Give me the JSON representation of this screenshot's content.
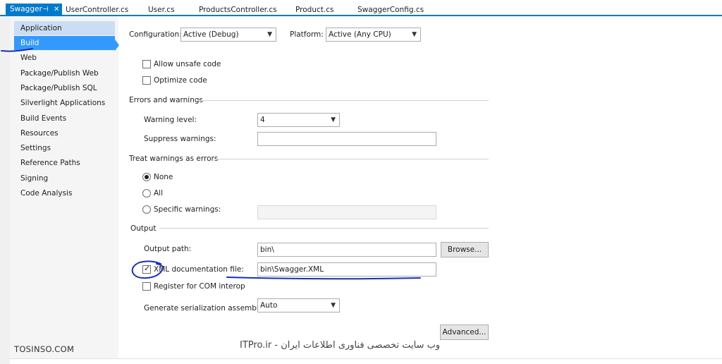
{
  "tabs": [
    {
      "label": "Swagger",
      "pin": "⊣",
      "close": "✕",
      "active": true
    },
    {
      "label": "UserController.cs"
    },
    {
      "label": "User.cs"
    },
    {
      "label": "ProductsController.cs"
    },
    {
      "label": "Product.cs"
    },
    {
      "label": "SwaggerConfig.cs"
    }
  ],
  "sidebar": {
    "items": [
      {
        "label": "Application"
      },
      {
        "label": "Build"
      },
      {
        "label": "Web"
      },
      {
        "label": "Package/Publish Web"
      },
      {
        "label": "Package/Publish SQL"
      },
      {
        "label": "Silverlight Applications"
      },
      {
        "label": "Build Events"
      },
      {
        "label": "Resources"
      },
      {
        "label": "Settings"
      },
      {
        "label": "Reference Paths"
      },
      {
        "label": "Signing"
      },
      {
        "label": "Code Analysis"
      }
    ]
  },
  "config": {
    "configuration_label": "Configuration:",
    "configuration_value": "Active (Debug)",
    "platform_label": "Platform:",
    "platform_value": "Active (Any CPU)"
  },
  "general": {
    "unsafe_label": "Allow unsafe code",
    "unsafe_checked": false,
    "optimize_label": "Optimize code",
    "optimize_checked": false
  },
  "errors": {
    "heading": "Errors and warnings",
    "warning_level_label": "Warning level:",
    "warning_level_value": "4",
    "suppress_label": "Suppress warnings:",
    "suppress_value": ""
  },
  "treat": {
    "heading": "Treat warnings as errors",
    "none_label": "None",
    "all_label": "All",
    "specific_label": "Specific warnings:",
    "selected": "None"
  },
  "output": {
    "heading": "Output",
    "path_label": "Output path:",
    "path_value": "bin\\",
    "browse_label": "Browse...",
    "xml_label": "XML documentation file:",
    "xml_checked": true,
    "xml_value": "bin\\Swagger.XML",
    "com_label": "Register for COM interop",
    "com_checked": false,
    "serialization_label": "Generate serialization assembly:",
    "serialization_value": "Auto"
  },
  "advanced_label": "Advanced...",
  "watermark": {
    "left": "TOSINSO.COM",
    "right": "ITPro.ir - وب سایت تخصصی فناوری اطلاعات ایران"
  },
  "colors": {
    "accent": "#007acc",
    "selected": "#3399ff",
    "annotation": "#1a2fb5"
  }
}
